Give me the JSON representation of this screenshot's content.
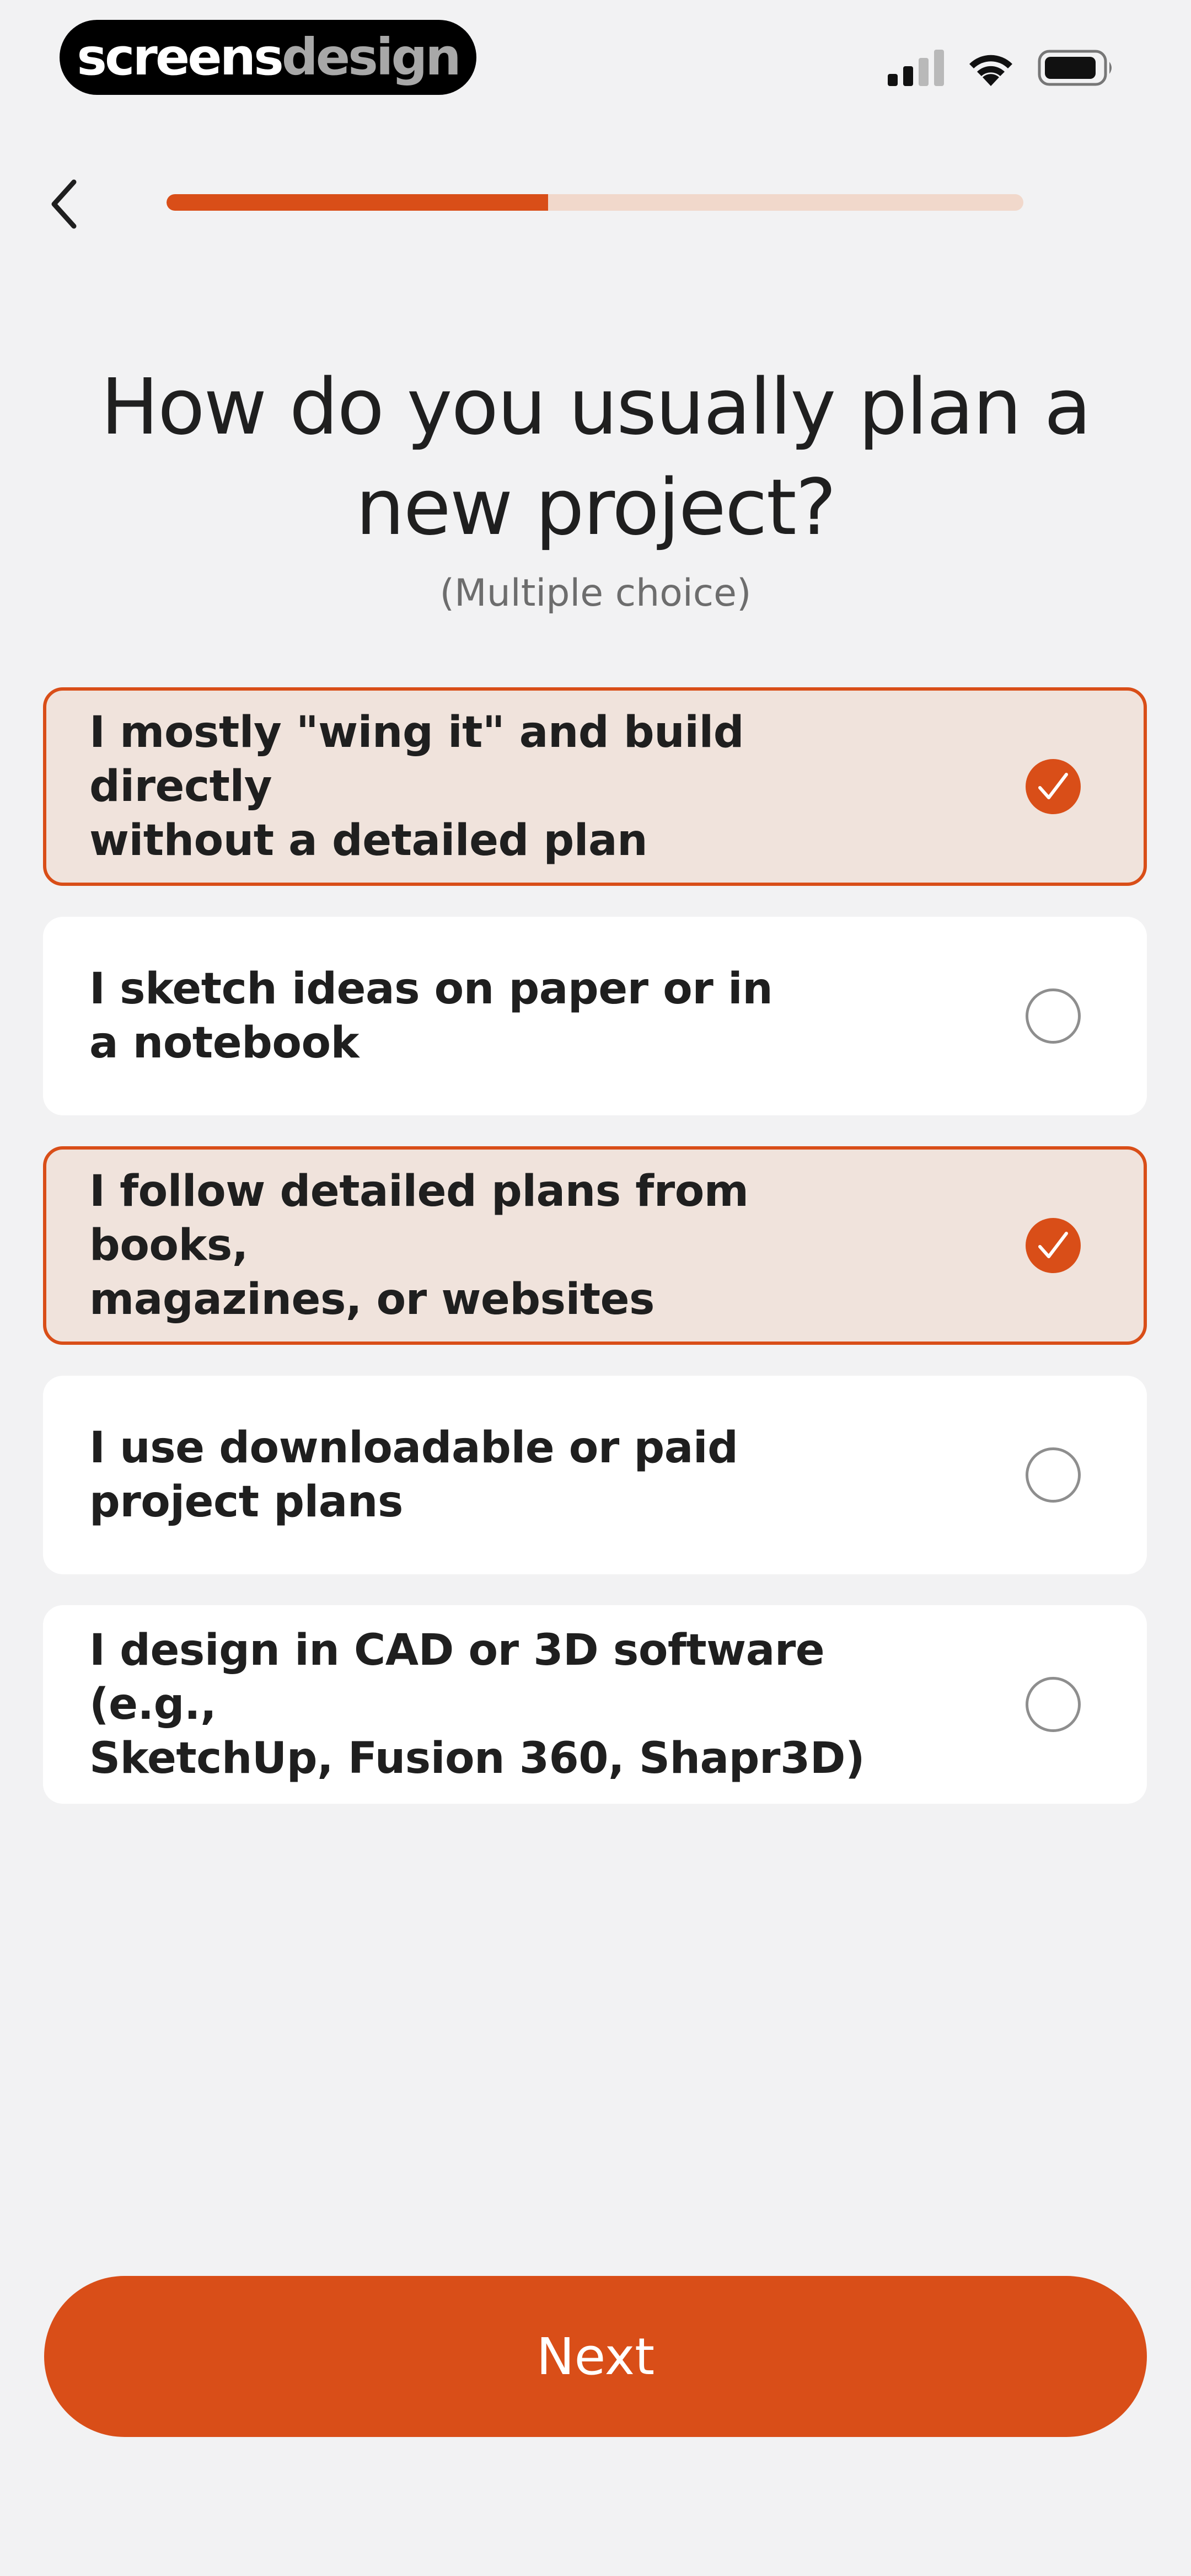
{
  "brand": {
    "part1": "screens",
    "part2": "design"
  },
  "status_bar": {
    "signal_icon": "cellular-signal-icon",
    "wifi_icon": "wifi-icon",
    "battery_icon": "battery-icon"
  },
  "header": {
    "back_icon": "chevron-left-icon",
    "progress_fraction": 0.445
  },
  "question": {
    "title_line1": "How do you usually plan a",
    "title_line2": "new project?",
    "subtitle": "(Multiple choice)"
  },
  "options": [
    {
      "line1": "I mostly \"wing it\" and build directly",
      "line2": "without a detailed plan",
      "selected": true
    },
    {
      "line1": "I sketch ideas on paper or in",
      "line2": "a notebook",
      "selected": false
    },
    {
      "line1": "I follow detailed plans from books,",
      "line2": "magazines, or websites",
      "selected": true
    },
    {
      "line1": "I use downloadable or paid",
      "line2": "project plans",
      "selected": false
    },
    {
      "line1": "I design in CAD or 3D software (e.g.,",
      "line2": "SketchUp, Fusion 360, Shapr3D)",
      "selected": false
    }
  ],
  "next_button": {
    "label": "Next"
  },
  "colors": {
    "accent": "#d94e18",
    "accent_soft": "#f0e3dc",
    "track": "#f1d8cb",
    "background": "#f2f2f3"
  }
}
